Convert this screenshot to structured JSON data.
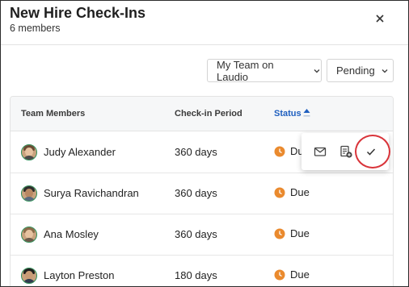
{
  "dialog": {
    "title": "New Hire Check-Ins",
    "subtitle": "6 members",
    "close_icon": "close-icon"
  },
  "filters": {
    "team": "My Team on Laudio",
    "status": "Pending"
  },
  "table": {
    "columns": [
      "Team Members",
      "Check-in Period",
      "Status"
    ],
    "sort": {
      "column": "Status",
      "direction": "ascending"
    },
    "rows": [
      {
        "name": "Judy Alexander",
        "period": "360 days",
        "status": "Due"
      },
      {
        "name": "Surya Ravichandran",
        "period": "360 days",
        "status": "Due"
      },
      {
        "name": "Ana Mosley",
        "period": "360 days",
        "status": "Due"
      },
      {
        "name": "Layton Preston",
        "period": "180 days",
        "status": "Due"
      }
    ]
  },
  "row_actions": {
    "icons": [
      "mail-icon",
      "note-add-icon",
      "check-icon"
    ],
    "highlighted": "check-icon"
  },
  "colors": {
    "accent": "#1f5fbf",
    "status_due": "#ea8a2e",
    "highlight": "#d9343a",
    "avatar_ring": "#2f8f5a"
  }
}
